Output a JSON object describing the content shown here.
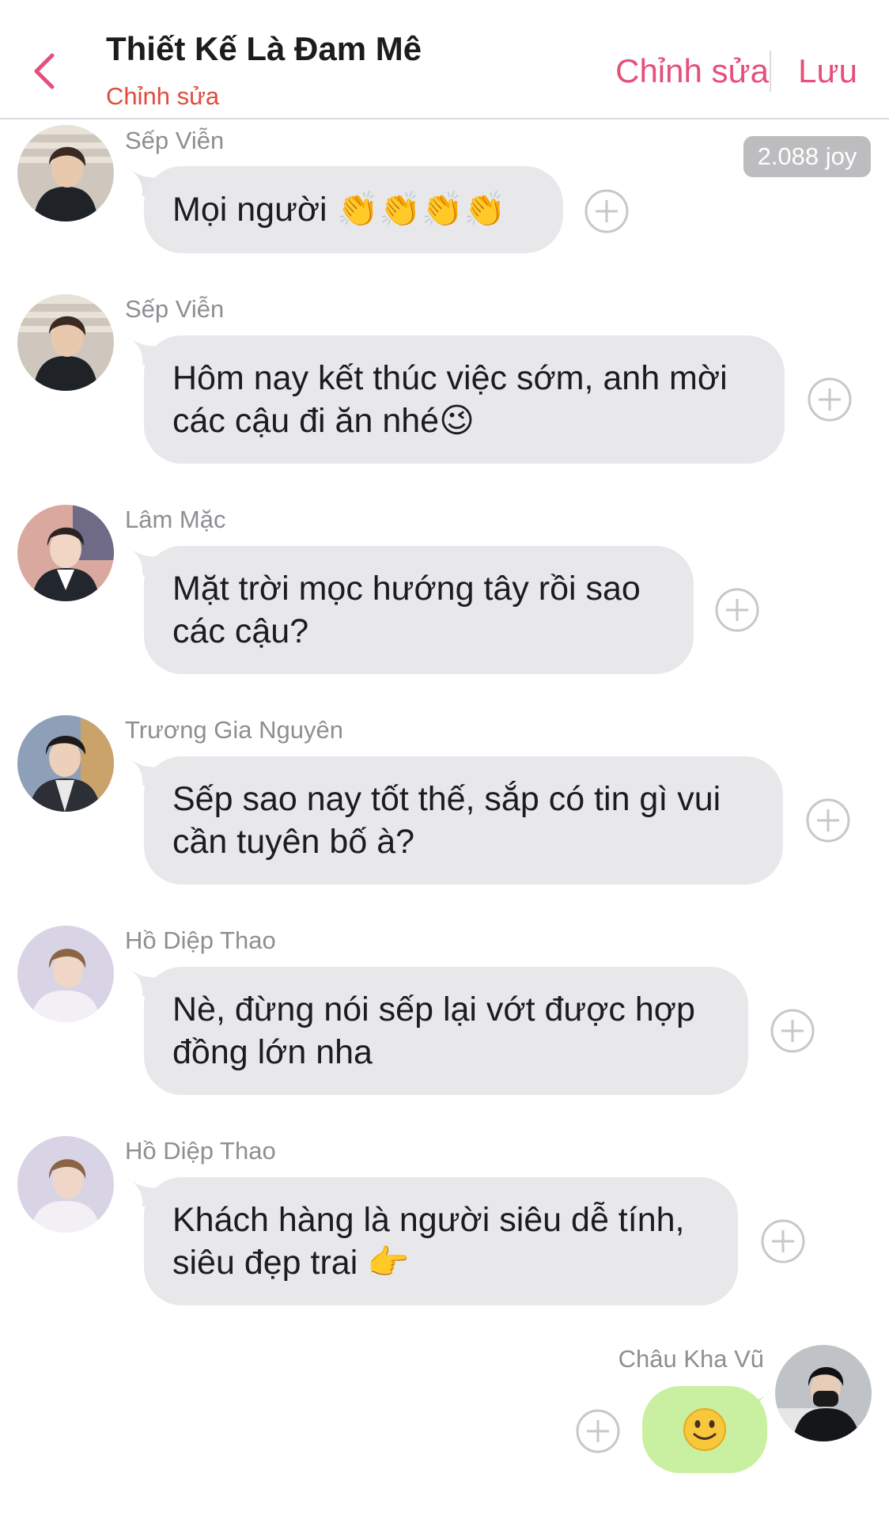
{
  "header": {
    "back_icon": "chevron-left-icon",
    "title": "Thiết Kế Là Đam Mê",
    "subtitle": "Chỉnh sửa",
    "edit_label": "Chỉnh sửa",
    "save_label": "Lưu",
    "accent_color": "#e5507a"
  },
  "joy_badge": "2.088 joy",
  "messages": [
    {
      "sender": "Sếp Viễn",
      "text": "Mọi người 👏👏👏👏"
    },
    {
      "sender": "Sếp Viễn",
      "line1": "Hôm nay kết thúc việc sớm, anh mời",
      "line2": "các cậu đi ăn nhé😉"
    },
    {
      "sender": "Lâm Mặc",
      "line1": "Mặt trời mọc hướng tây rồi sao",
      "line2": "các cậu?"
    },
    {
      "sender": "Trương Gia Nguyên",
      "line1": "Sếp sao nay tốt thế, sắp có tin gì vui",
      "line2": "cần tuyên bố à?"
    },
    {
      "sender": "Hồ Diệp Thao",
      "line1": "Nè, đừng nói sếp lại vớt được hợp",
      "line2": "đồng lớn nha"
    },
    {
      "sender": "Hồ Diệp Thao",
      "line1": "Khách hàng là người siêu dễ tính,",
      "line2": "siêu đẹp trai 👉"
    }
  ],
  "own_message": {
    "sender": "Châu Kha Vũ",
    "text": "🙂",
    "bubble_color": "#c9f0a0"
  },
  "add_icon": "plus-circle-icon"
}
